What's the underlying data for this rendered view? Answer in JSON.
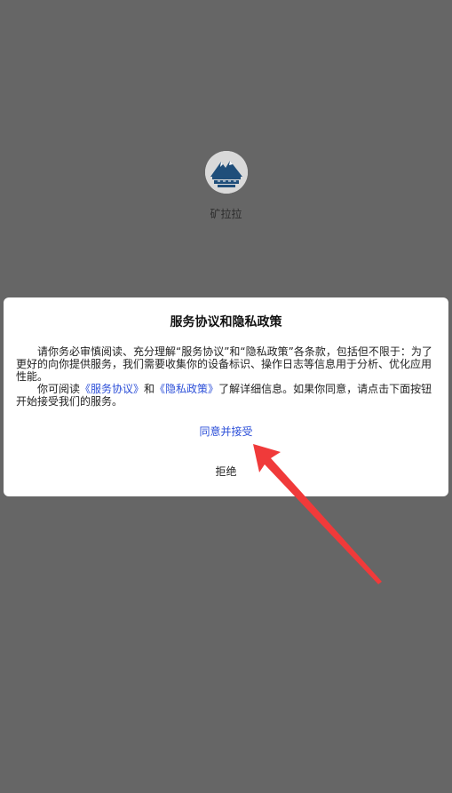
{
  "app": {
    "name": "矿拉拉",
    "logo_icon": "mountain-logo-icon"
  },
  "dialog": {
    "title": "服务协议和隐私政策",
    "paragraph1": "请你务必审慎阅读、充分理解“服务协议”和“隐私政策”各条款，包括但不限于：为了更好的向你提供服务，我们需要收集你的设备标识、操作日志等信息用于分析、优化应用性能。",
    "paragraph2_prefix": "你可阅读",
    "service_link": "《服务协议》",
    "and_text": "和",
    "privacy_link": "《隐私政策》",
    "paragraph2_suffix": "了解详细信息。如果你同意，请点击下面按钮开始接受我们的服务。",
    "agree_label": "同意并接受",
    "reject_label": "拒绝"
  },
  "colors": {
    "overlay": "#666666",
    "link": "#2c4fd8",
    "arrow": "#f03a3a"
  },
  "annotation": {
    "icon": "red-arrow-icon"
  }
}
